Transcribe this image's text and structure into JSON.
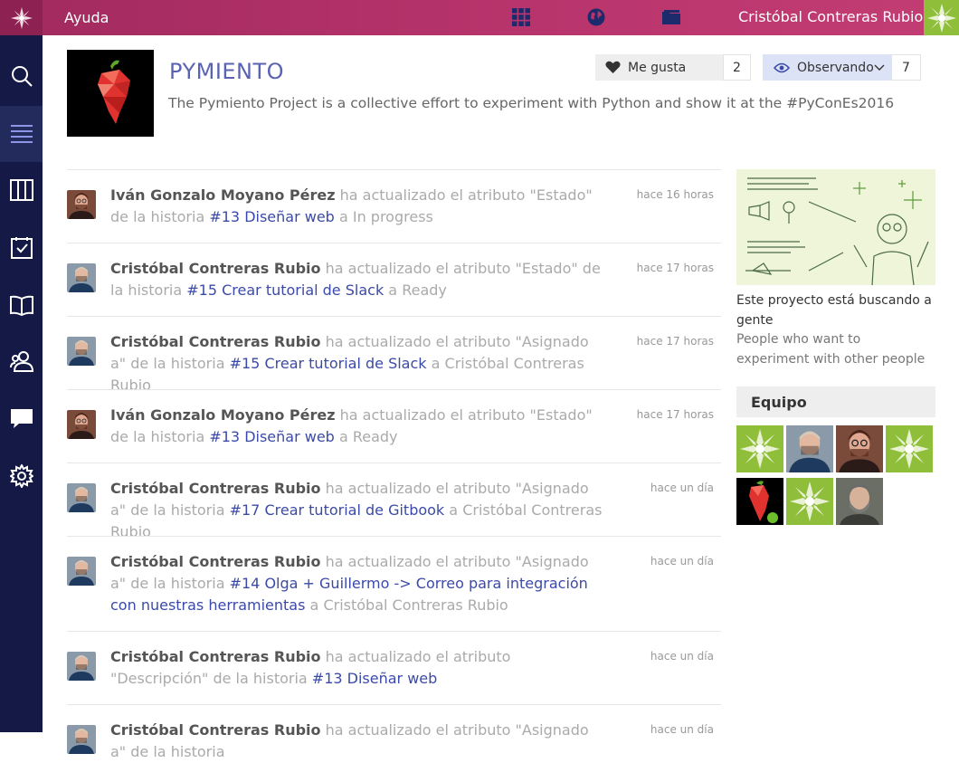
{
  "topbar": {
    "help_label": "Ayuda",
    "user_name": "Cristóbal Contreras Rubio",
    "icons": [
      "taiga-logo-icon",
      "grid-apps-icon",
      "globe-icon",
      "folder-icon"
    ]
  },
  "sidebar": {
    "items": [
      {
        "name": "search",
        "icon": "search-icon"
      },
      {
        "name": "timeline",
        "icon": "list-icon",
        "active": true
      },
      {
        "name": "kanban",
        "icon": "columns-icon"
      },
      {
        "name": "issues",
        "icon": "checklist-icon"
      },
      {
        "name": "wiki",
        "icon": "book-icon"
      },
      {
        "name": "team",
        "icon": "users-icon"
      },
      {
        "name": "chat",
        "icon": "chat-icon"
      },
      {
        "name": "settings",
        "icon": "gear-icon"
      }
    ]
  },
  "project": {
    "title": "PYMIENTO",
    "description": "The Pymiento Project is a collective effort to experiment with Python and show it at the #PyConEs2016",
    "like_label": "Me gusta",
    "like_count": "2",
    "watch_label": "Observando",
    "watch_count": "7"
  },
  "timeline": [
    {
      "user": "Iván Gonzalo Moyano Pérez",
      "action": "ha actualizado el atributo \"Estado\" de la",
      "object_type": "historia",
      "story": "#13 Diseñar web",
      "to_prefix": "a",
      "value": "In progress",
      "time": "hace 16 horas",
      "avatar": "ivan"
    },
    {
      "user": "Cristóbal Contreras Rubio",
      "action": "ha actualizado el atributo \"Estado\" de la",
      "object_type": "historia",
      "story": "#15 Crear tutorial de Slack",
      "to_prefix": "a",
      "value": "Ready",
      "time": "hace 17 horas",
      "avatar": "cristobal"
    },
    {
      "user": "Cristóbal Contreras Rubio",
      "action": "ha actualizado el atributo \"Asignado a\" de la",
      "object_type": "historia",
      "story": "#15 Crear tutorial de Slack",
      "to_prefix": "a",
      "value": "Cristóbal Contreras Rubio",
      "time": "hace 17 horas",
      "avatar": "cristobal"
    },
    {
      "user": "Iván Gonzalo Moyano Pérez",
      "action": "ha actualizado el atributo \"Estado\" de la",
      "object_type": "historia",
      "story": "#13 Diseñar web",
      "to_prefix": "a",
      "value": "Ready",
      "time": "hace 17 horas",
      "avatar": "ivan"
    },
    {
      "user": "Cristóbal Contreras Rubio",
      "action": "ha actualizado el atributo \"Asignado a\" de la",
      "object_type": "historia",
      "story": "#17 Crear tutorial de Gitbook",
      "to_prefix": "a",
      "value": "Cristóbal Contreras Rubio",
      "time": "hace un día",
      "avatar": "cristobal"
    },
    {
      "user": "Cristóbal Contreras Rubio",
      "action": "ha actualizado el atributo \"Asignado a\" de la",
      "object_type": "historia",
      "story": "#14 Olga + Guillermo -> Correo para integración con nuestras herramientas",
      "to_prefix": "a",
      "value": "Cristóbal Contreras Rubio",
      "time": "hace un día",
      "avatar": "cristobal"
    },
    {
      "user": "Cristóbal Contreras Rubio",
      "action": "ha actualizado el atributo \"Descripción\" de la",
      "object_type": "historia",
      "story": "#13 Diseñar web",
      "to_prefix": "",
      "value": "",
      "time": "hace un día",
      "avatar": "cristobal"
    },
    {
      "user": "Cristóbal Contreras Rubio",
      "action": "ha actualizado el atributo \"Asignado a\" de la",
      "object_type": "historia",
      "story": "",
      "to_prefix": "",
      "value": "",
      "time": "hace un día",
      "avatar": "cristobal"
    }
  ],
  "promo": {
    "title": "Este proyecto está buscando a gente",
    "subtitle": "People who want to experiment with other people"
  },
  "team": {
    "heading": "Equipo",
    "members": [
      "default",
      "cristobal",
      "ivan",
      "default",
      "pepper",
      "default",
      "bearded"
    ]
  },
  "colors": {
    "topbar": "#b8346c",
    "sidebar": "#141a45",
    "link": "#3b4aa8",
    "accent_green": "#8fbf3a"
  }
}
